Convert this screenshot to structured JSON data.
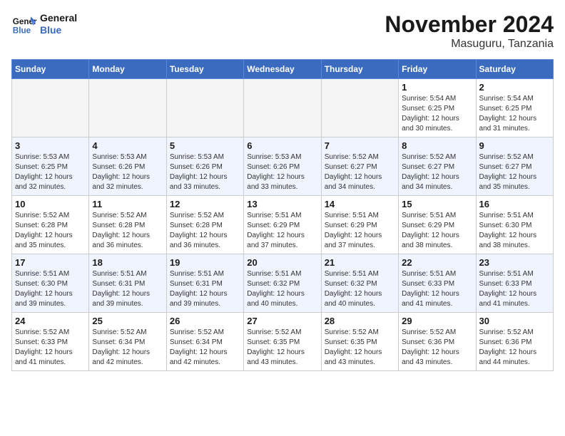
{
  "logo": {
    "line1": "General",
    "line2": "Blue"
  },
  "title": "November 2024",
  "location": "Masuguru, Tanzania",
  "weekdays": [
    "Sunday",
    "Monday",
    "Tuesday",
    "Wednesday",
    "Thursday",
    "Friday",
    "Saturday"
  ],
  "weeks": [
    [
      {
        "day": "",
        "info": ""
      },
      {
        "day": "",
        "info": ""
      },
      {
        "day": "",
        "info": ""
      },
      {
        "day": "",
        "info": ""
      },
      {
        "day": "",
        "info": ""
      },
      {
        "day": "1",
        "info": "Sunrise: 5:54 AM\nSunset: 6:25 PM\nDaylight: 12 hours\nand 30 minutes."
      },
      {
        "day": "2",
        "info": "Sunrise: 5:54 AM\nSunset: 6:25 PM\nDaylight: 12 hours\nand 31 minutes."
      }
    ],
    [
      {
        "day": "3",
        "info": "Sunrise: 5:53 AM\nSunset: 6:25 PM\nDaylight: 12 hours\nand 32 minutes."
      },
      {
        "day": "4",
        "info": "Sunrise: 5:53 AM\nSunset: 6:26 PM\nDaylight: 12 hours\nand 32 minutes."
      },
      {
        "day": "5",
        "info": "Sunrise: 5:53 AM\nSunset: 6:26 PM\nDaylight: 12 hours\nand 33 minutes."
      },
      {
        "day": "6",
        "info": "Sunrise: 5:53 AM\nSunset: 6:26 PM\nDaylight: 12 hours\nand 33 minutes."
      },
      {
        "day": "7",
        "info": "Sunrise: 5:52 AM\nSunset: 6:27 PM\nDaylight: 12 hours\nand 34 minutes."
      },
      {
        "day": "8",
        "info": "Sunrise: 5:52 AM\nSunset: 6:27 PM\nDaylight: 12 hours\nand 34 minutes."
      },
      {
        "day": "9",
        "info": "Sunrise: 5:52 AM\nSunset: 6:27 PM\nDaylight: 12 hours\nand 35 minutes."
      }
    ],
    [
      {
        "day": "10",
        "info": "Sunrise: 5:52 AM\nSunset: 6:28 PM\nDaylight: 12 hours\nand 35 minutes."
      },
      {
        "day": "11",
        "info": "Sunrise: 5:52 AM\nSunset: 6:28 PM\nDaylight: 12 hours\nand 36 minutes."
      },
      {
        "day": "12",
        "info": "Sunrise: 5:52 AM\nSunset: 6:28 PM\nDaylight: 12 hours\nand 36 minutes."
      },
      {
        "day": "13",
        "info": "Sunrise: 5:51 AM\nSunset: 6:29 PM\nDaylight: 12 hours\nand 37 minutes."
      },
      {
        "day": "14",
        "info": "Sunrise: 5:51 AM\nSunset: 6:29 PM\nDaylight: 12 hours\nand 37 minutes."
      },
      {
        "day": "15",
        "info": "Sunrise: 5:51 AM\nSunset: 6:29 PM\nDaylight: 12 hours\nand 38 minutes."
      },
      {
        "day": "16",
        "info": "Sunrise: 5:51 AM\nSunset: 6:30 PM\nDaylight: 12 hours\nand 38 minutes."
      }
    ],
    [
      {
        "day": "17",
        "info": "Sunrise: 5:51 AM\nSunset: 6:30 PM\nDaylight: 12 hours\nand 39 minutes."
      },
      {
        "day": "18",
        "info": "Sunrise: 5:51 AM\nSunset: 6:31 PM\nDaylight: 12 hours\nand 39 minutes."
      },
      {
        "day": "19",
        "info": "Sunrise: 5:51 AM\nSunset: 6:31 PM\nDaylight: 12 hours\nand 39 minutes."
      },
      {
        "day": "20",
        "info": "Sunrise: 5:51 AM\nSunset: 6:32 PM\nDaylight: 12 hours\nand 40 minutes."
      },
      {
        "day": "21",
        "info": "Sunrise: 5:51 AM\nSunset: 6:32 PM\nDaylight: 12 hours\nand 40 minutes."
      },
      {
        "day": "22",
        "info": "Sunrise: 5:51 AM\nSunset: 6:33 PM\nDaylight: 12 hours\nand 41 minutes."
      },
      {
        "day": "23",
        "info": "Sunrise: 5:51 AM\nSunset: 6:33 PM\nDaylight: 12 hours\nand 41 minutes."
      }
    ],
    [
      {
        "day": "24",
        "info": "Sunrise: 5:52 AM\nSunset: 6:33 PM\nDaylight: 12 hours\nand 41 minutes."
      },
      {
        "day": "25",
        "info": "Sunrise: 5:52 AM\nSunset: 6:34 PM\nDaylight: 12 hours\nand 42 minutes."
      },
      {
        "day": "26",
        "info": "Sunrise: 5:52 AM\nSunset: 6:34 PM\nDaylight: 12 hours\nand 42 minutes."
      },
      {
        "day": "27",
        "info": "Sunrise: 5:52 AM\nSunset: 6:35 PM\nDaylight: 12 hours\nand 43 minutes."
      },
      {
        "day": "28",
        "info": "Sunrise: 5:52 AM\nSunset: 6:35 PM\nDaylight: 12 hours\nand 43 minutes."
      },
      {
        "day": "29",
        "info": "Sunrise: 5:52 AM\nSunset: 6:36 PM\nDaylight: 12 hours\nand 43 minutes."
      },
      {
        "day": "30",
        "info": "Sunrise: 5:52 AM\nSunset: 6:36 PM\nDaylight: 12 hours\nand 44 minutes."
      }
    ]
  ]
}
